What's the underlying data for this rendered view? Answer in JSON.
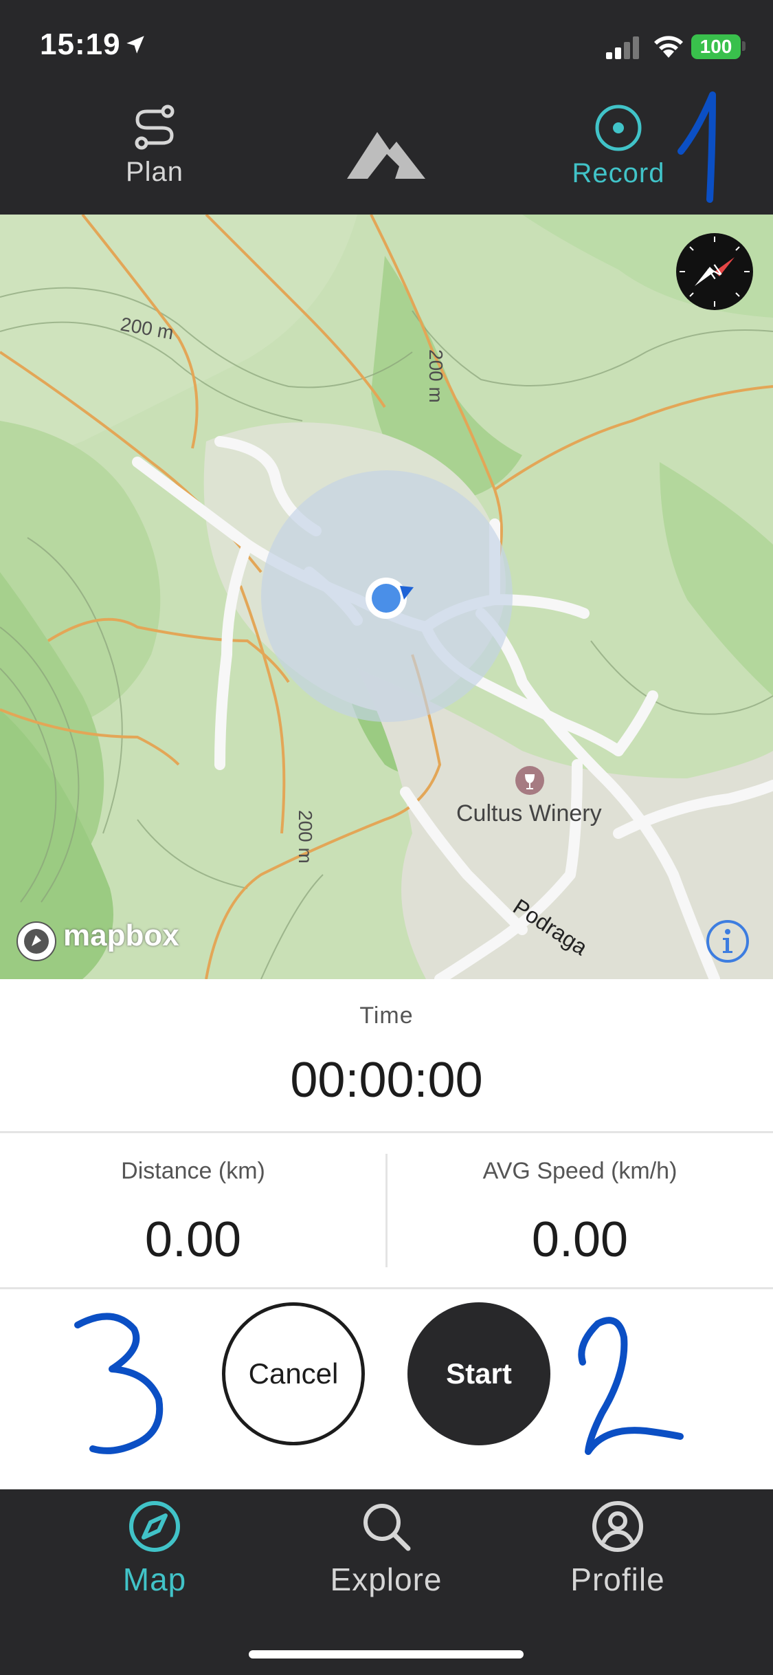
{
  "status_bar": {
    "time": "15:19",
    "battery": "100",
    "icons": [
      "location-arrow-icon",
      "signal-icon",
      "wifi-icon",
      "battery-icon"
    ]
  },
  "top_nav": {
    "plan_label": "Plan",
    "record_label": "Record",
    "active_tab": "Record",
    "icons": [
      "route-icon",
      "mountain-logo-icon",
      "record-target-icon"
    ]
  },
  "map": {
    "place_label": "Cultus Winery",
    "road_label": "Podraga",
    "elevation_labels": [
      "200 m",
      "200 m",
      "200 m"
    ],
    "attribution": "mapbox",
    "icons": [
      "compass-icon",
      "user-location-icon",
      "winery-poi-icon",
      "mapbox-logo-icon",
      "info-icon"
    ]
  },
  "stats": {
    "time_label": "Time",
    "time_value": "00:00:00",
    "distance_label": "Distance (km)",
    "distance_value": "0.00",
    "speed_label": "AVG Speed (km/h)",
    "speed_value": "0.00"
  },
  "actions": {
    "cancel_label": "Cancel",
    "start_label": "Start"
  },
  "annotations": [
    "1",
    "2",
    "3"
  ],
  "bottom_nav": {
    "items": [
      {
        "label": "Map",
        "icon": "compass-nav-icon",
        "active": true
      },
      {
        "label": "Explore",
        "icon": "search-icon",
        "active": false
      },
      {
        "label": "Profile",
        "icon": "profile-icon",
        "active": false
      }
    ]
  },
  "colors": {
    "bar_bg": "#28282a",
    "accent": "#41c3c8",
    "map_green": "#c9e0b6",
    "location_blue": "#4a8fe8",
    "annotation_ink": "#0b4fc4"
  }
}
